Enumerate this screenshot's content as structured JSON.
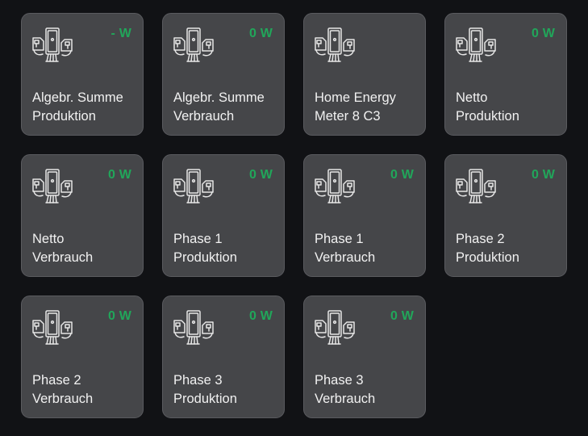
{
  "tiles": [
    {
      "value": "- W",
      "line1": "Algebr. Summe",
      "line2": "Produktion",
      "icon": "energy-meter-icon"
    },
    {
      "value": "0 W",
      "line1": "Algebr. Summe",
      "line2": "Verbrauch",
      "icon": "energy-meter-icon"
    },
    {
      "value": "",
      "line1": "Home Energy",
      "line2": "Meter 8 C3",
      "icon": "energy-meter-icon"
    },
    {
      "value": "0 W",
      "line1": "Netto",
      "line2": "Produktion",
      "icon": "energy-meter-icon"
    },
    {
      "value": "0 W",
      "line1": "Netto",
      "line2": "Verbrauch",
      "icon": "energy-meter-icon"
    },
    {
      "value": "0 W",
      "line1": "Phase 1",
      "line2": "Produktion",
      "icon": "energy-meter-icon"
    },
    {
      "value": "0 W",
      "line1": "Phase 1",
      "line2": "Verbrauch",
      "icon": "energy-meter-icon"
    },
    {
      "value": "0 W",
      "line1": "Phase 2",
      "line2": "Produktion",
      "icon": "energy-meter-icon"
    },
    {
      "value": "0 W",
      "line1": "Phase 2",
      "line2": "Verbrauch",
      "icon": "energy-meter-icon"
    },
    {
      "value": "0 W",
      "line1": "Phase 3",
      "line2": "Produktion",
      "icon": "energy-meter-icon"
    },
    {
      "value": "0 W",
      "line1": "Phase 3",
      "line2": "Verbrauch",
      "icon": "energy-meter-icon"
    }
  ],
  "colors": {
    "background": "#111215",
    "tile": "#454649",
    "value_green": "#21a65a",
    "text": "#f1f1f1"
  }
}
